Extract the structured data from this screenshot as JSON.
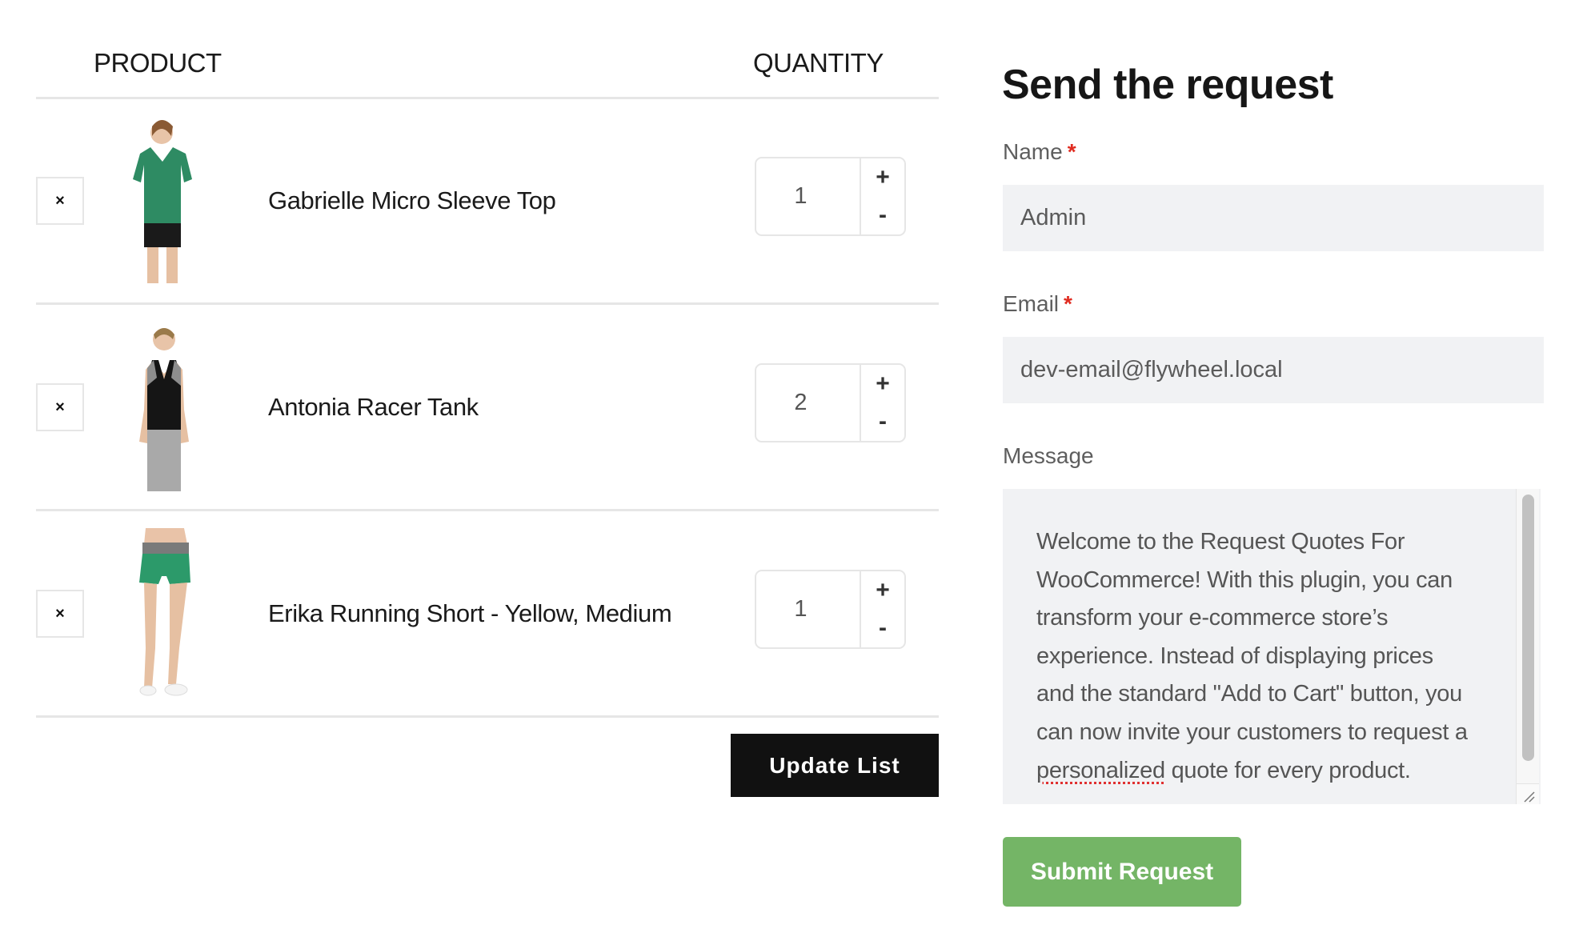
{
  "table": {
    "headers": {
      "product": "PRODUCT",
      "quantity": "QUANTITY"
    },
    "remove_icon": "×",
    "items": [
      {
        "name": "Gabrielle Micro Sleeve Top",
        "quantity": "1",
        "image": "woman-green-tshirt",
        "top_color": "#2e8b63",
        "bottom_color": "#1a1a1a"
      },
      {
        "name": "Antonia Racer Tank",
        "quantity": "2",
        "image": "woman-black-tank",
        "top_color": "#151515",
        "bottom_color": "#a9a9a9"
      },
      {
        "name": "Erika Running Short - Yellow, Medium",
        "quantity": "1",
        "image": "woman-green-shorts",
        "top_color": "#e9c3a8",
        "bottom_color": "#2c9a6a"
      }
    ],
    "stepper": {
      "plus": "+",
      "minus": "-"
    },
    "update_label": "Update List"
  },
  "form": {
    "title": "Send the request",
    "required_marker": "*",
    "name": {
      "label": "Name",
      "value": "Admin"
    },
    "email": {
      "label": "Email",
      "value": "dev-email@flywheel.local"
    },
    "message": {
      "label": "Message",
      "lines": [
        "Welcome to the Request Quotes For",
        "WooCommerce! With this plugin, you can",
        "transform your e-commerce store’s",
        "experience. Instead of displaying prices",
        "and the standard \"Add to Cart\" button, you",
        "can now invite your customers to request a"
      ],
      "last_line_misspelled": "personalized",
      "last_line_rest": " quote for every product."
    },
    "submit_label": "Submit Request",
    "submit_color": "#74b566"
  }
}
